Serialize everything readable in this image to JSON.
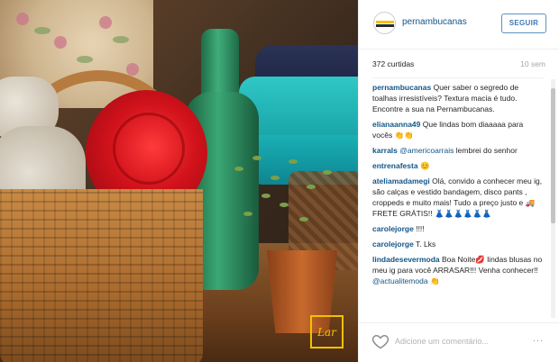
{
  "post": {
    "account": "pernambucanas",
    "follow_label": "SEGUIR",
    "likes": "372 curtidas",
    "time": "10 sem",
    "brand_logo_text": "Lar"
  },
  "comments": [
    {
      "user": "pernambucanas",
      "text": "Quer saber o segredo de toalhas irresistíveis? Textura macia é tudo. Encontre a sua na Pernambucanas."
    },
    {
      "user": "elianaanna49",
      "text": "Que lindas bom diaaaaa para vocês 👏👏"
    },
    {
      "user": "karrals",
      "mention": "@americoarrais",
      "text": "lembrei do senhor"
    },
    {
      "user": "entrenafesta",
      "text": "😊"
    },
    {
      "user": "ateliamadamegi",
      "text": "Olá, convido a conhecer meu ig, são calças e vestido bandagem, disco pants , croppeds e muito mais! Tudo a preço justo e 🚚FRETE GRÁTIS!! 👗👗👗👗👗👗"
    },
    {
      "user": "carolejorge",
      "text": "!!!!"
    },
    {
      "user": "carolejorge",
      "text": "T. Lks"
    },
    {
      "user": "lindadesevermoda",
      "text": "Boa Noite💋 lindas blusas no meu ig para você ARRASAR!!! Venha conhecer!!",
      "mention": "@actualitemoda",
      "tail": "👏"
    }
  ],
  "footer": {
    "comment_placeholder": "Adicione um comentário...",
    "more_label": "..."
  },
  "icons": {
    "like": "heart-outline-icon",
    "options": "more-options-icon"
  },
  "colors": {
    "link": "#125688",
    "follow_border": "#5b91c2",
    "brand_yellow": "#f2c200"
  }
}
